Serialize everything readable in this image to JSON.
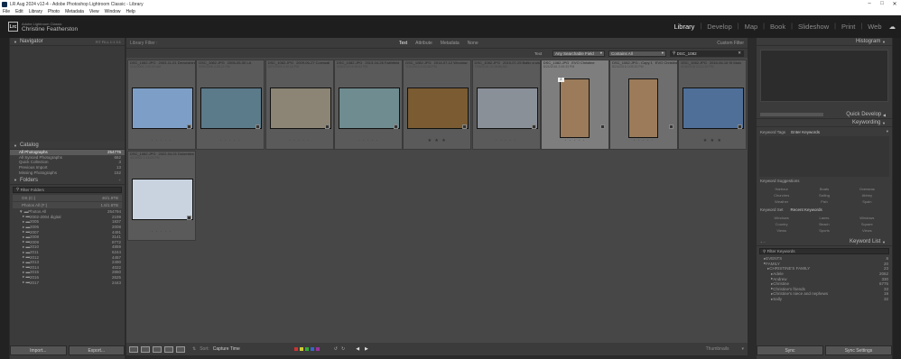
{
  "window": {
    "title": "LR Aug 2024 v12-4 - Adobe Photoshop Lightroom Classic - Library"
  },
  "menu": [
    "File",
    "Edit",
    "Library",
    "Photo",
    "Metadata",
    "View",
    "Window",
    "Help"
  ],
  "identity": {
    "app": "Adobe Lightroom Classic",
    "user": "Christine Featherston"
  },
  "modules": [
    "Library",
    "Develop",
    "Map",
    "Book",
    "Slideshow",
    "Print",
    "Web"
  ],
  "left": {
    "navigator": "Navigator",
    "catalog": {
      "title": "Catalog",
      "items": [
        {
          "label": "All Photographs",
          "count": "254776"
        },
        {
          "label": "All Synced Photographs",
          "count": "662"
        },
        {
          "label": "Quick Collection",
          "count": "3"
        },
        {
          "label": "Previous Import",
          "count": "13"
        },
        {
          "label": "Missing Photographs",
          "count": "152"
        }
      ]
    },
    "folders": {
      "title": "Folders",
      "filter": "Filter Folders",
      "drives": [
        {
          "label": "OS (C:)",
          "count": "46/1.9TB"
        },
        {
          "label": "Photos All (F:)",
          "count": "1.6/1.8TB"
        }
      ],
      "root": {
        "label": "Photos All",
        "count": "254794"
      },
      "items": [
        {
          "label": "2002-2004 digital",
          "count": "2199"
        },
        {
          "label": "2005",
          "count": "1837"
        },
        {
          "label": "2006",
          "count": "2008"
        },
        {
          "label": "2007",
          "count": "4491"
        },
        {
          "label": "2008",
          "count": "3141"
        },
        {
          "label": "2009",
          "count": "8772"
        },
        {
          "label": "2010",
          "count": "4859"
        },
        {
          "label": "2011",
          "count": "6244"
        },
        {
          "label": "2012",
          "count": "4457"
        },
        {
          "label": "2013",
          "count": "2490"
        },
        {
          "label": "2014",
          "count": "4022"
        },
        {
          "label": "2015",
          "count": "2860"
        },
        {
          "label": "2016",
          "count": "2625"
        },
        {
          "label": "2017",
          "count": "2443"
        }
      ]
    },
    "import": "Import...",
    "export": "Export..."
  },
  "filter": {
    "title": "Library Filter :",
    "tabs": [
      "Text",
      "Attribute",
      "Metadata",
      "None"
    ],
    "preset": "Custom Filter",
    "text_label": "Text",
    "field": "Any Searchable Field",
    "rule": "Contains All",
    "query": "DSC_1082"
  },
  "grid": [
    {
      "name": "DSC_1082.JPG",
      "meta": "2003-11-01 Devonshire",
      "date": "11/1/2003 1:00:00 AM",
      "stars": "· · · · ·",
      "color": "#7d9fc7",
      "tall": false,
      "sel": false
    },
    {
      "name": "DSC_1082.JPG",
      "meta": "2006-05-30 LA",
      "date": "5/30/2006 2:36:21 PM",
      "stars": "· · · · ·",
      "color": "#5b7a8a",
      "tall": false,
      "sel": false
    },
    {
      "name": "DSC_1082.JPG",
      "meta": "2009-06-27 Cornwall",
      "date": "6/27/2009 4:49:24 PM",
      "stars": "· · · · ·",
      "color": "#8c8474",
      "tall": false,
      "sel": false
    },
    {
      "name": "DSC_1082.JPG",
      "meta": "2013-04-26 Faithfield",
      "date": "4/26/2013 5:08:52 PM",
      "stars": "· · · · ·",
      "color": "#6f8c90",
      "tall": false,
      "sel": false
    },
    {
      "name": "DSC_1082.JPG",
      "meta": "2014-07-12 Wroclaw",
      "date": "7/12/2014 4:32:58 PM",
      "stars": "★ ★ ★",
      "color": "#7a5b32",
      "tall": false,
      "sel": false
    },
    {
      "name": "DSC_1082.JPG",
      "meta": "2015-07-25 Baltic cruise",
      "date": "7/25/2015 10:28:56 AM",
      "stars": "· · · · ·",
      "color": "#8a9098",
      "tall": false,
      "sel": false
    },
    {
      "name": "DSC_1082.JPG",
      "meta": "EVO Christine",
      "date": "8/24/2016 2:05:33 PM",
      "stars": "· · · · ·",
      "color": "#9b7b5a",
      "tall": true,
      "sel": true,
      "index": "2"
    },
    {
      "name": "DSC_1082.JPG - Copy 1",
      "meta": "EVO Christine",
      "date": "8/24/2016 2:05:33 PM",
      "stars": "· · · · ·",
      "color": "#9b7b5a",
      "tall": true,
      "sel": true
    },
    {
      "name": "DSC_1082.JPG",
      "meta": "2016-06-16 St Malo",
      "date": "6/16/2016 12:11:10 PM",
      "stars": "★ ★ ★",
      "color": "#4f6f99",
      "tall": false,
      "sel": false
    },
    {
      "name": "DSC_1082.JPG",
      "meta": "2022-04-01 Dolomites",
      "date": "4/1/2022 1:14:09 PM",
      "stars": "· · · · ·",
      "color": "#c9d3e0",
      "tall": false,
      "sel": false
    }
  ],
  "toolbar": {
    "sort_label": "Sort:",
    "sort": "Capture Time",
    "thumbs": "Thumbnails"
  },
  "right": {
    "histogram": "Histogram",
    "quick": "Quick Develop",
    "keywording": "Keywording",
    "tags": "Keyword Tags",
    "tags_value": "Enter Keywords",
    "suggestions": "Keyword Suggestions",
    "sug": [
      "Harbour",
      "Boats",
      "Overseas",
      "Churches",
      "Sailing",
      "Abbey",
      "Weather",
      "Fish",
      "Spain"
    ],
    "set": "Keyword Set",
    "set_value": "Recent Keywords",
    "recent": [
      "Windows",
      "Lanes",
      "Windows",
      "Country",
      "Beach",
      "Square",
      "Views",
      "Sports",
      "Views"
    ],
    "list": "Keyword List",
    "filter": "Filter Keywords",
    "keywords": [
      {
        "label": "EVENTS",
        "count": "8"
      },
      {
        "label": "FAMILY",
        "count": "20"
      },
      {
        "label": "CHRISTINE'S FAMILY",
        "count": "23"
      },
      {
        "label": "Adele",
        "count": "2062"
      },
      {
        "label": "Andrew",
        "count": "330"
      },
      {
        "label": "Christine",
        "count": "6775"
      },
      {
        "label": "Christine's friends",
        "count": "33"
      },
      {
        "label": "Christine's niece and nephews",
        "count": "19"
      },
      {
        "label": "Sally",
        "count": "32"
      }
    ],
    "sync": "Sync",
    "sync_settings": "Sync Settings"
  }
}
